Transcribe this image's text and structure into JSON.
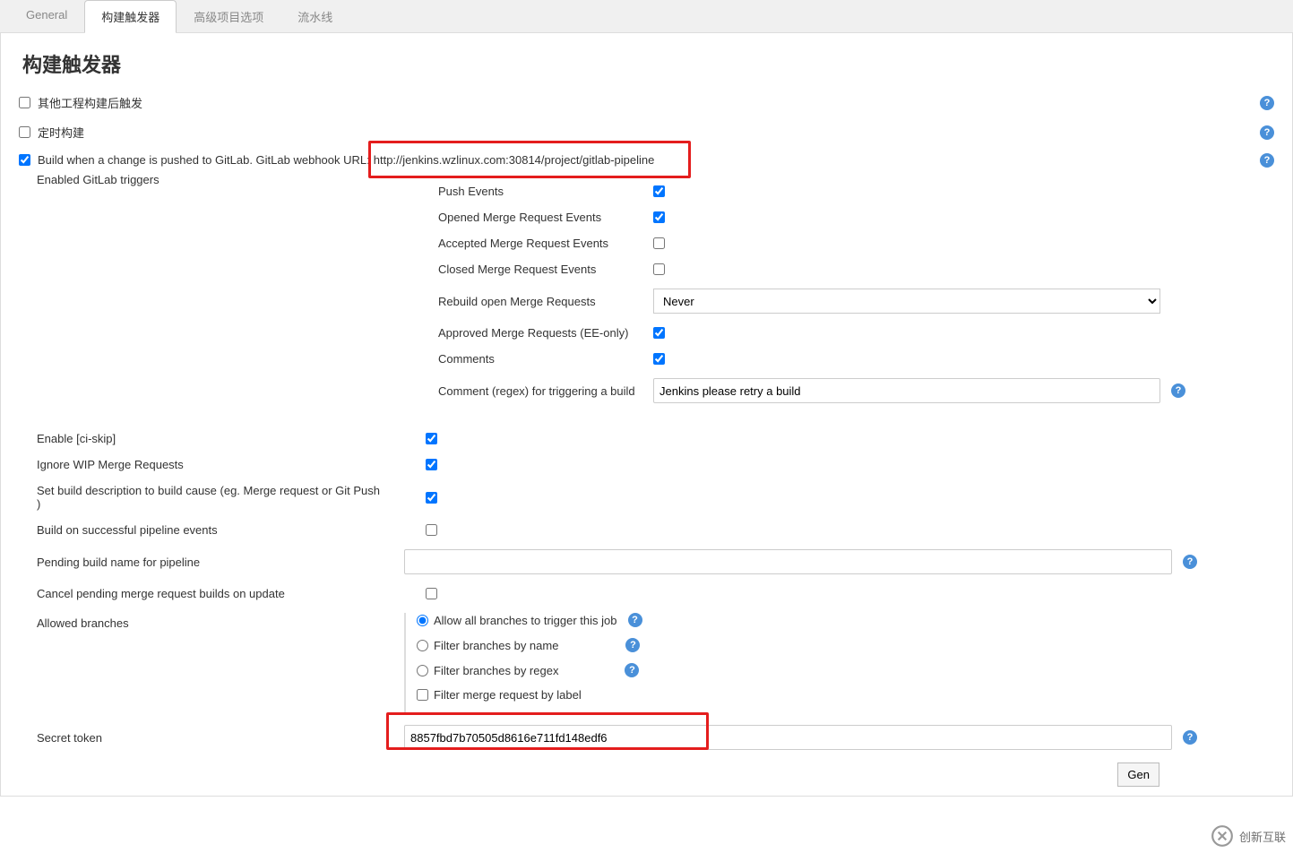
{
  "tabs": {
    "general": "General",
    "buildTriggers": "构建触发器",
    "advancedOptions": "高级项目选项",
    "pipeline": "流水线"
  },
  "section": {
    "title": "构建触发器"
  },
  "triggers": {
    "otherBuild": "其他工程构建后触发",
    "cron": "定时构建",
    "gitlabPushPrefix": "Build when a change is pushed to GitLab. GitLab webhook URL:",
    "gitlabWebhookUrl": "http://jenkins.wzlinux.com:30814/project/gitlab-pipeline",
    "enabledGitlabTriggers": "Enabled GitLab triggers"
  },
  "gitlabTriggers": {
    "pushEvents": "Push Events",
    "openedMR": "Opened Merge Request Events",
    "acceptedMR": "Accepted Merge Request Events",
    "closedMR": "Closed Merge Request Events",
    "rebuildOpenMR": "Rebuild open Merge Requests",
    "rebuildOpenMRValue": "Never",
    "approvedMR": "Approved Merge Requests (EE-only)",
    "comments": "Comments",
    "commentRegex": "Comment (regex) for triggering a build",
    "commentRegexValue": "Jenkins please retry a build"
  },
  "options": {
    "enableCiSkip": "Enable [ci-skip]",
    "ignoreWip": "Ignore WIP Merge Requests",
    "setBuildDesc": "Set build description to build cause (eg. Merge request or Git Push )",
    "buildOnPipelineSuccess": "Build on successful pipeline events",
    "pendingBuildName": "Pending build name for pipeline",
    "pendingBuildNameValue": "",
    "cancelPending": "Cancel pending merge request builds on update",
    "allowedBranches": "Allowed branches",
    "secretToken": "Secret token",
    "secretTokenValue": "8857fbd7b70505d8616e711fd148edf6"
  },
  "allowedBranches": {
    "allowAll": "Allow all branches to trigger this job",
    "byName": "Filter branches by name",
    "byRegex": "Filter branches by regex",
    "byLabel": "Filter merge request by label"
  },
  "buttons": {
    "generate": "Gen"
  },
  "watermark": "创新互联"
}
